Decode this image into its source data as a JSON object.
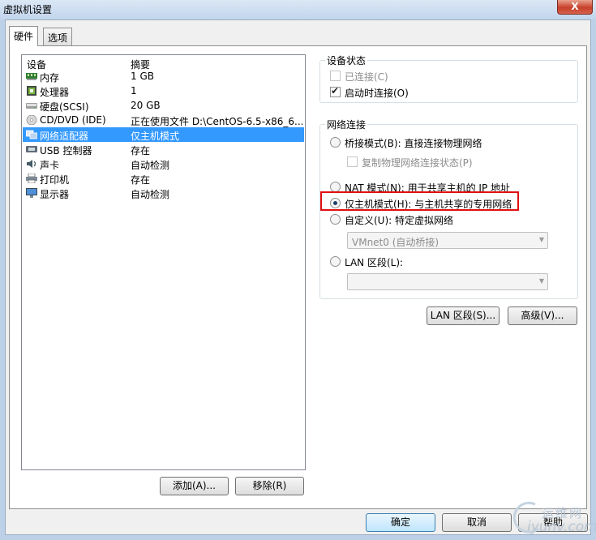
{
  "window": {
    "title": "虚拟机设置",
    "close_label": "X"
  },
  "tabs": [
    {
      "label": "硬件",
      "active": true
    },
    {
      "label": "选项",
      "active": false
    }
  ],
  "device_list": {
    "headers": {
      "device": "设备",
      "summary": "摘要"
    },
    "rows": [
      {
        "name": "内存",
        "summary": "1 GB",
        "icon": "memory-icon"
      },
      {
        "name": "处理器",
        "summary": "1",
        "icon": "processor-icon"
      },
      {
        "name": "硬盘(SCSI)",
        "summary": "20 GB",
        "icon": "harddisk-icon"
      },
      {
        "name": "CD/DVD (IDE)",
        "summary": "正在使用文件 D:\\CentOS-6.5-x86_6...",
        "icon": "cd-dvd-icon"
      },
      {
        "name": "网络适配器",
        "summary": "仅主机模式",
        "icon": "network-adapter-icon",
        "selected": true
      },
      {
        "name": "USB 控制器",
        "summary": "存在",
        "icon": "usb-icon"
      },
      {
        "name": "声卡",
        "summary": "自动检测",
        "icon": "sound-icon"
      },
      {
        "name": "打印机",
        "summary": "存在",
        "icon": "printer-icon"
      },
      {
        "name": "显示器",
        "summary": "自动检测",
        "icon": "display-icon"
      }
    ]
  },
  "device_status": {
    "title": "设备状态",
    "connected": {
      "label": "已连接(C)",
      "checked": false,
      "enabled": false
    },
    "connect_at_power_on": {
      "label": "启动时连接(O)",
      "checked": true,
      "enabled": true
    }
  },
  "network_connection": {
    "title": "网络连接",
    "bridged": {
      "label": "桥接模式(B): 直接连接物理网络"
    },
    "replicate": {
      "label": "复制物理网络连接状态(P)"
    },
    "nat": {
      "label": "NAT 模式(N): 用于共享主机的 IP 地址"
    },
    "host_only": {
      "label": "仅主机模式(H): 与主机共享的专用网络",
      "selected": true
    },
    "custom": {
      "label": "自定义(U): 特定虚拟网络",
      "combo_value": "VMnet0 (自动桥接)"
    },
    "lan_segment": {
      "label": "LAN 区段(L):",
      "combo_value": ""
    }
  },
  "buttons": {
    "lan_segments": "LAN 区段(S)...",
    "advanced": "高级(V)...",
    "add": "添加(A)...",
    "remove": "移除(R)",
    "ok": "确定",
    "cancel": "取消",
    "help": "帮助"
  },
  "watermark": {
    "line1": "运维网",
    "line2": "iyunv.com"
  },
  "colors": {
    "selection": "#3399ff",
    "highlight_box": "#e01010",
    "close_button": "#c7402a"
  }
}
